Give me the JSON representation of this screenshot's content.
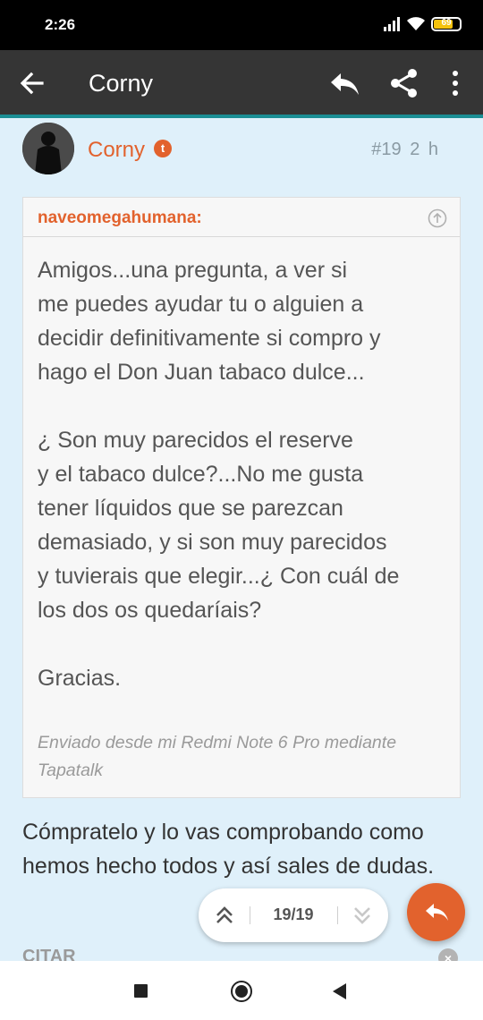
{
  "status_bar": {
    "time": "2:26",
    "battery_level": "69"
  },
  "app_bar": {
    "title": "Corny",
    "back_icon": "arrow-left-icon",
    "reply_icon": "reply-icon",
    "share_icon": "share-icon",
    "more_icon": "more-vert-icon"
  },
  "post": {
    "author": "Corny",
    "number": "#19",
    "time": "2 h",
    "quote": {
      "author": "naveomegahumana:",
      "paragraphs": [
        "Amigos...una pregunta, a ver si\nme puedes ayudar tu o alguien a\ndecidir definitivamente si compro y\nhago el Don Juan tabaco dulce...",
        "¿ Son muy parecidos el reserve\ny el tabaco dulce?...No me gusta\ntener líquidos que se parezcan\ndemasiado, y si son muy parecidos\ny tuvierais que elegir...¿ Con cuál de\nlos dos os quedaríais?",
        "Gracias."
      ],
      "signature": "Enviado desde mi Redmi Note 6 Pro mediante Tapatalk"
    },
    "reply": "Cómpratelo y lo vas comprobando como hemos hecho todos y así sales de dudas.",
    "quote_label": "CITAR"
  },
  "pager": {
    "count": "19/19"
  },
  "colors": {
    "accent": "#e2622d",
    "app_bar": "#353535",
    "teal": "#1b8e94",
    "background": "#dff0fa"
  }
}
